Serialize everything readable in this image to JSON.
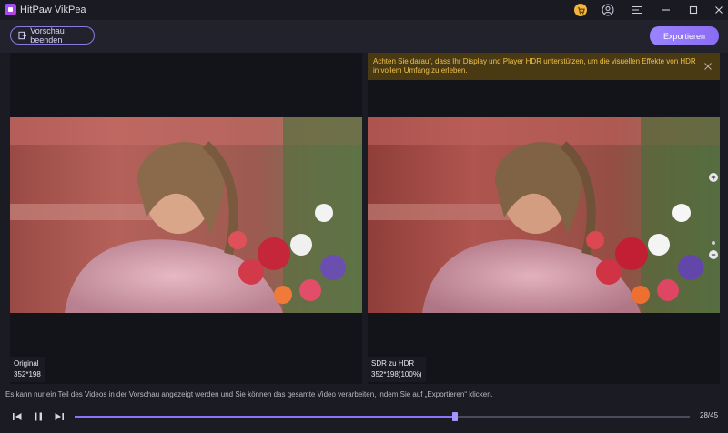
{
  "app": {
    "title": "HitPaw VikPea"
  },
  "toolbar": {
    "exit_label": "Vorschau beenden",
    "export_label": "Exportieren"
  },
  "left_panel": {
    "name": "Original",
    "resolution": "352*198"
  },
  "right_panel": {
    "notice": "Achten Sie darauf, dass Ihr Display und Player HDR unterstützen, um die visuellen Effekte von HDR in vollem Umfang zu erleben.",
    "name": "SDR zu HDR",
    "resolution": "352*198(100%)"
  },
  "zoom": {
    "in_symbol": "+",
    "out_symbol": "−"
  },
  "status": {
    "message": "Es kann nur ein Teil des Videos in der Vorschau angezeigt werden und Sie können das gesamte Video verarbeiten, indem Sie auf „Exportieren“ klicken."
  },
  "player": {
    "time": "28/45",
    "progress": 0.618
  },
  "colors": {
    "accent": "#8a6cf2",
    "notice_bg": "#4a3a14",
    "notice_text": "#f0c24c"
  }
}
